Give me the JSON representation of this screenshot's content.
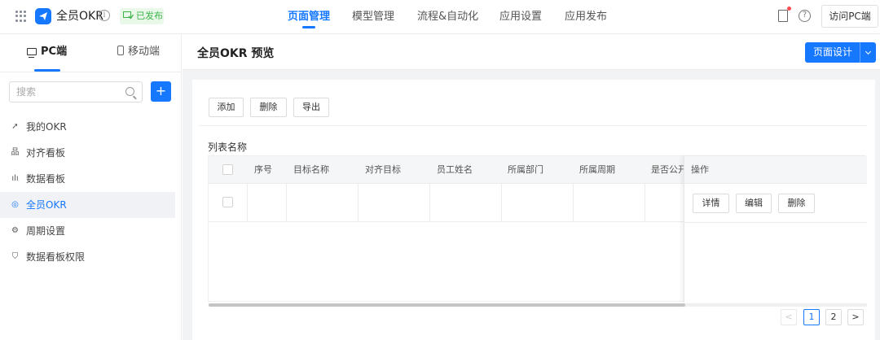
{
  "app": {
    "name": "全员OKR",
    "status_badge": "已发布",
    "accent": "#1677ff"
  },
  "topnav": {
    "items": [
      {
        "label": "页面管理",
        "active": true
      },
      {
        "label": "模型管理"
      },
      {
        "label": "流程&自动化"
      },
      {
        "label": "应用设置"
      },
      {
        "label": "应用发布"
      }
    ],
    "visit_pc_label": "访问PC端",
    "help_glyph": "?"
  },
  "sidebar": {
    "tabs": [
      {
        "label": "PC端",
        "active": true,
        "icon": "monitor-icon"
      },
      {
        "label": "移动端",
        "icon": "phone-icon"
      }
    ],
    "search_placeholder": "搜索",
    "add_glyph": "+",
    "items": [
      {
        "label": "我的OKR",
        "icon": "send-icon",
        "glyph": "➚"
      },
      {
        "label": "对齐看板",
        "icon": "org-tree-icon",
        "glyph": "品"
      },
      {
        "label": "数据看板",
        "icon": "bar-chart-icon",
        "glyph": "ılı"
      },
      {
        "label": "全员OKR",
        "icon": "location-icon",
        "glyph": "◎",
        "active": true
      },
      {
        "label": "周期设置",
        "icon": "gear-icon",
        "glyph": "⚙"
      },
      {
        "label": "数据看板权限",
        "icon": "shield-icon",
        "glyph": "⛉"
      }
    ]
  },
  "main": {
    "title": "全员OKR 预览",
    "design_button": "页面设计",
    "toolbar": {
      "add": "添加",
      "delete": "删除",
      "export": "导出"
    },
    "list_title": "列表名称",
    "columns": [
      "序号",
      "目标名称",
      "对齐目标",
      "员工姓名",
      "所属部门",
      "所属周期",
      "是否公开"
    ],
    "ops_header": "操作",
    "row_ops": {
      "detail": "详情",
      "edit": "编辑",
      "delete": "删除"
    },
    "pagination": {
      "prev": "<",
      "pages": [
        "1",
        "2"
      ],
      "current": "1",
      "next": ">"
    }
  }
}
